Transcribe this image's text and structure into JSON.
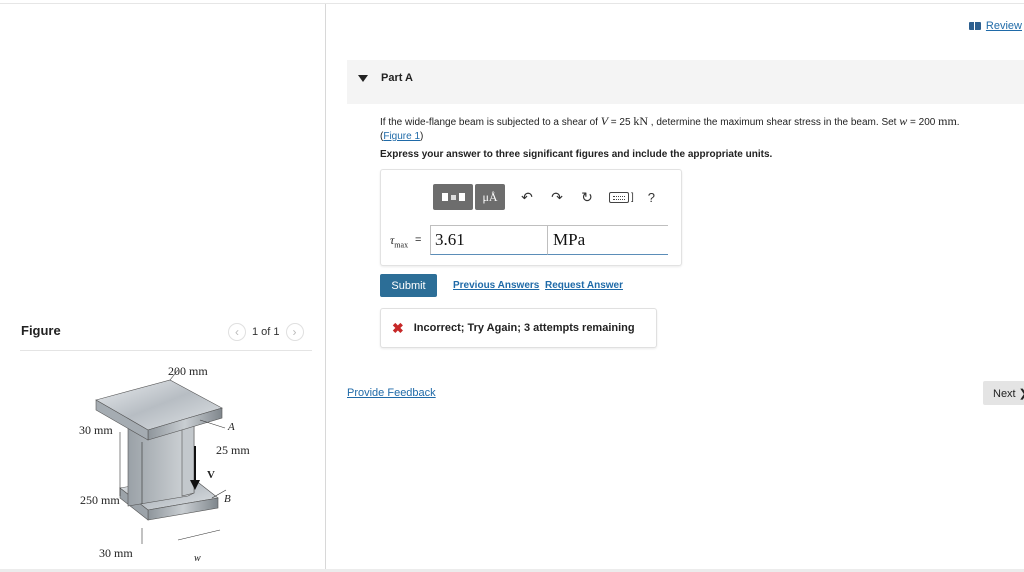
{
  "header": {
    "review_label": "Review",
    "review_icon": "book-icon"
  },
  "figure_panel": {
    "title": "Figure",
    "pager": "1 of 1",
    "prev_icon": "chevron-left-icon",
    "next_icon": "chevron-right-icon",
    "labels": {
      "top_width": "200 mm",
      "flange_thickness_top": "30 mm",
      "web_thickness": "25 mm",
      "web_height": "250 mm",
      "flange_thickness_bottom": "30 mm",
      "point_a": "A",
      "point_b": "B",
      "shear": "V",
      "w": "w"
    }
  },
  "part": {
    "title": "Part A",
    "question_pre": "If the wide-flange beam is subjected to a shear of ",
    "question_v": "V",
    "question_eq1": " = 25 ",
    "question_unit1": "kN",
    "question_mid": " , determine the maximum shear stress in the beam. Set ",
    "question_w": "w",
    "question_eq2": " = 200 ",
    "question_unit2": "mm",
    "question_end": ".",
    "figure_link": "Figure 1",
    "instruction": "Express your answer to three significant figures and include the appropriate units."
  },
  "answer": {
    "toolbar": {
      "templates_icon": "templates-icon",
      "units_label": "μÅ",
      "undo_icon": "undo-icon",
      "redo_icon": "redo-icon",
      "reset_icon": "reset-icon",
      "keyboard_icon": "keyboard-icon",
      "help_label": "?"
    },
    "variable": "τ",
    "variable_sub": "max",
    "equals": "=",
    "value": "3.61",
    "unit": "MPa"
  },
  "actions": {
    "submit_label": "Submit",
    "previous_answers": "Previous Answers",
    "request_answer": "Request Answer"
  },
  "feedback": {
    "status_icon": "x-icon",
    "message": "Incorrect; Try Again; 3 attempts remaining"
  },
  "footer": {
    "provide_feedback": "Provide Feedback",
    "next_label": "Next ❯"
  },
  "colors": {
    "link": "#1f6aa8",
    "submit_bg": "#2c6e97",
    "error": "#c62828",
    "toolbar_bg": "#6d6d6d"
  }
}
